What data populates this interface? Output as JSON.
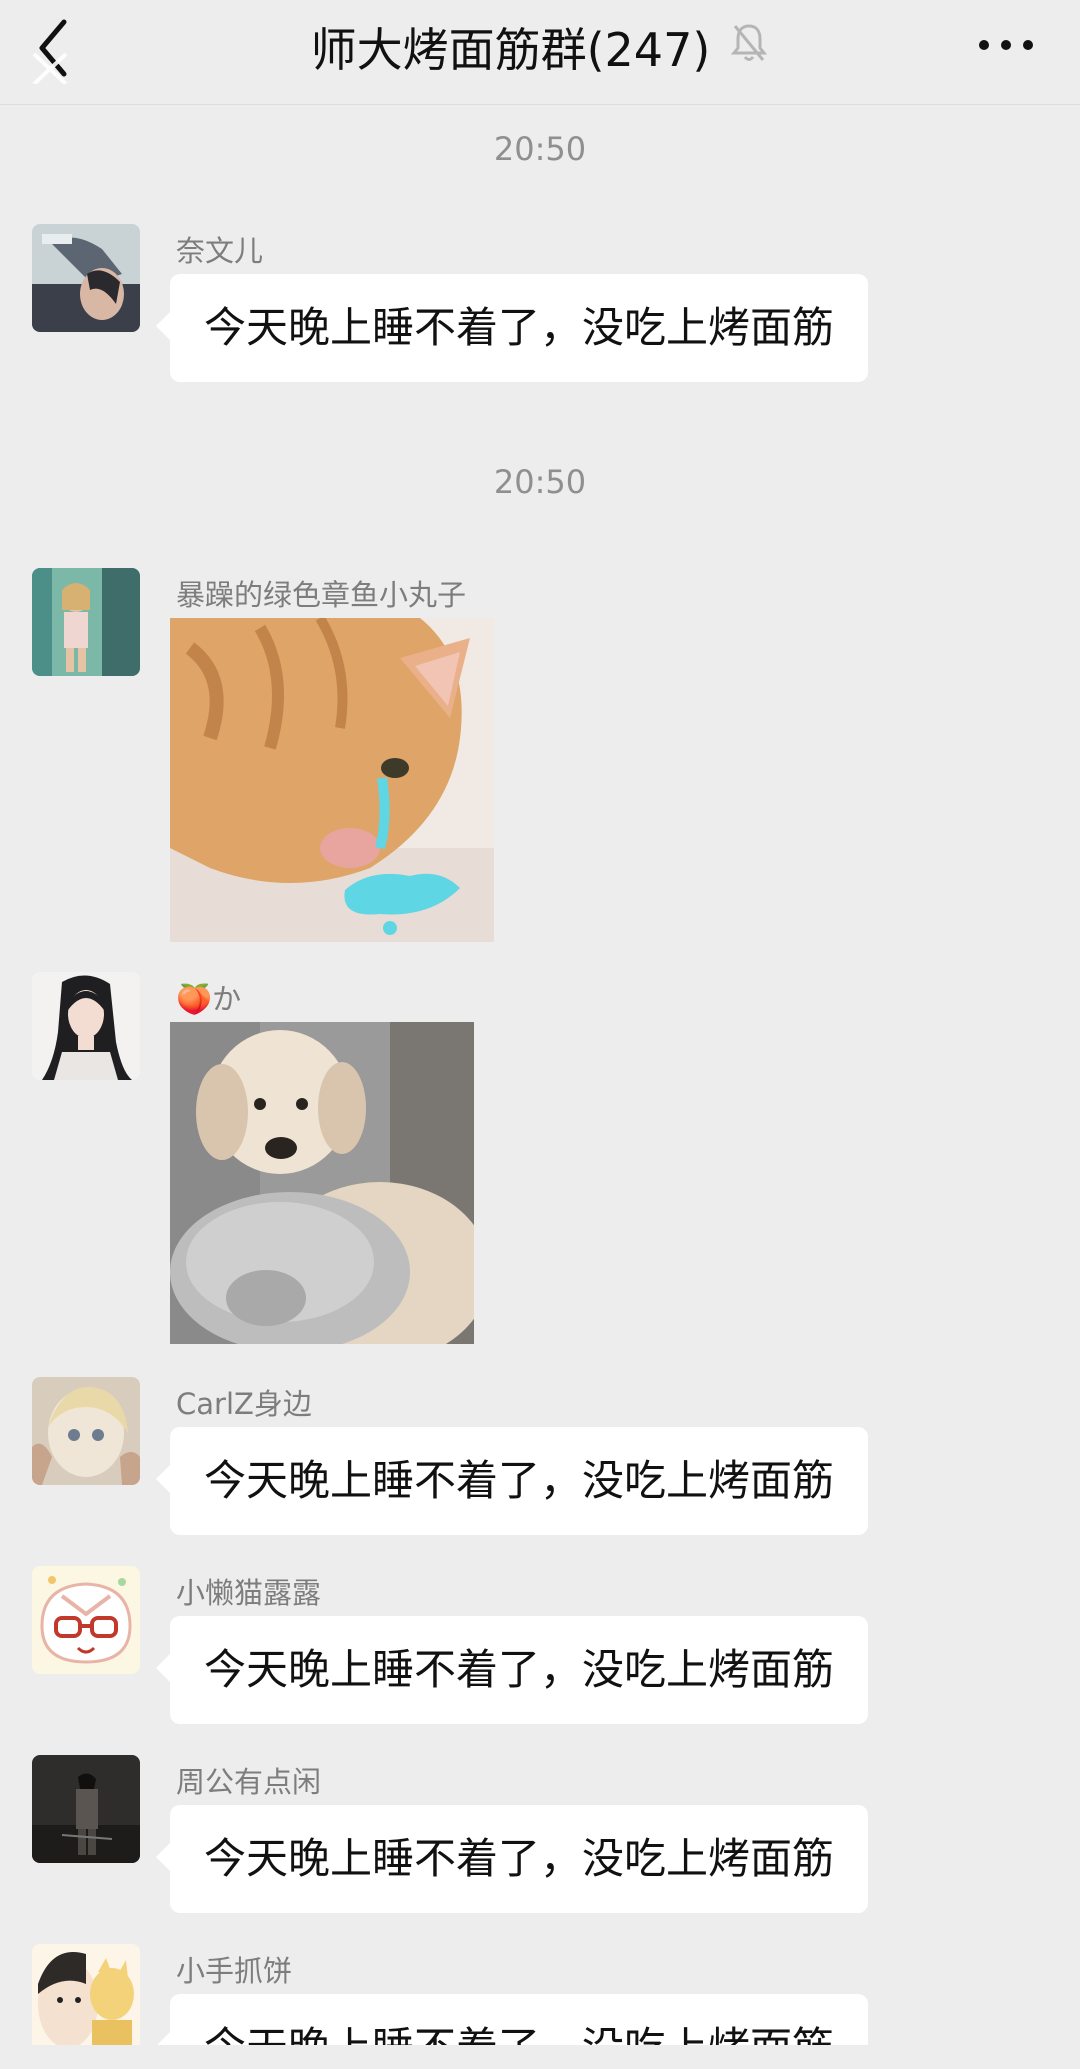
{
  "header": {
    "title": "师大烤面筋群(247)",
    "back_icon": "back-chevron-icon",
    "mute_icon": "muted-bell-icon",
    "more_icon": "more-dots-icon"
  },
  "timestamps": [
    "20:50",
    "20:50"
  ],
  "messages": [
    {
      "sender": "奈文儿",
      "text": "今天晚上睡不着了，没吃上烤面筋",
      "avatar": "avatar-1"
    },
    {
      "sender": "暴躁的绿色章鱼小丸子",
      "sticker": "crying-cat-sticker",
      "avatar": "avatar-2"
    },
    {
      "sender_emoji": "🍑",
      "sender": "か",
      "sticker": "dog-with-bowl-sticker",
      "avatar": "avatar-3"
    },
    {
      "sender": "CarlZ身边",
      "text": "今天晚上睡不着了，没吃上烤面筋",
      "avatar": "avatar-4"
    },
    {
      "sender": "小懒猫露露",
      "text": "今天晚上睡不着了，没吃上烤面筋",
      "avatar": "avatar-5"
    },
    {
      "sender": "周公有点闲",
      "text": "今天晚上睡不着了，没吃上烤面筋",
      "avatar": "avatar-6"
    },
    {
      "sender": "小手抓饼",
      "text": "今天晚上睡不着了，没吃上烤面筋",
      "avatar": "avatar-7"
    }
  ],
  "colors": {
    "background": "#ededed",
    "bubble": "#ffffff",
    "sender_text": "#7d7d7d",
    "timestamp_text": "#8f8f8f"
  }
}
